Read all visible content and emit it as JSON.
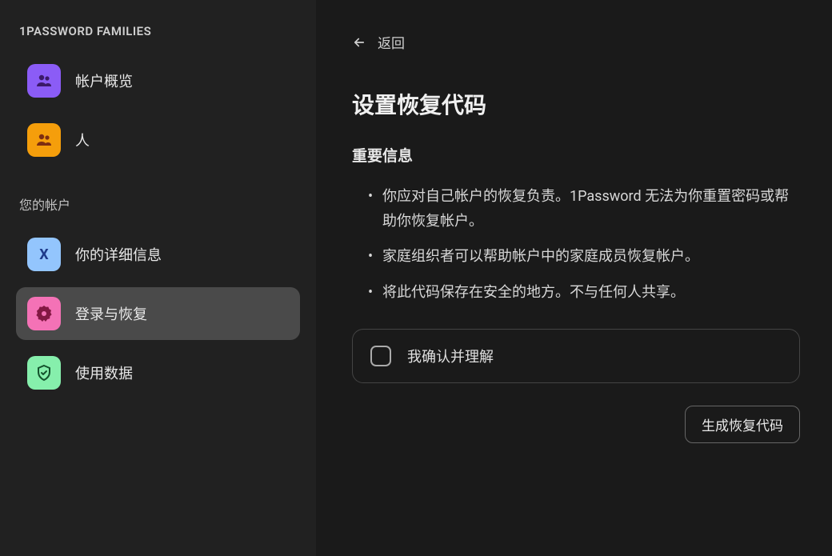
{
  "sidebar": {
    "header": "1PASSWORD FAMILIES",
    "nav_top": [
      {
        "label": "帐户概览",
        "icon": "users-group"
      },
      {
        "label": "人",
        "icon": "people"
      }
    ],
    "section_header": "您的帐户",
    "nav_account": [
      {
        "label": "你的详细信息",
        "icon": "x-mark"
      },
      {
        "label": "登录与恢复",
        "icon": "badge",
        "active": true
      },
      {
        "label": "使用数据",
        "icon": "shield"
      }
    ]
  },
  "main": {
    "back_label": "返回",
    "title": "设置恢复代码",
    "section_title": "重要信息",
    "info_items": [
      "你应对自己帐户的恢复负责。1Password 无法为你重置密码或帮助你恢复帐户。",
      "家庭组织者可以帮助帐户中的家庭成员恢复帐户。",
      "将此代码保存在安全的地方。不与任何人共享。"
    ],
    "confirm_label": "我确认并理解",
    "generate_button": "生成恢复代码"
  }
}
